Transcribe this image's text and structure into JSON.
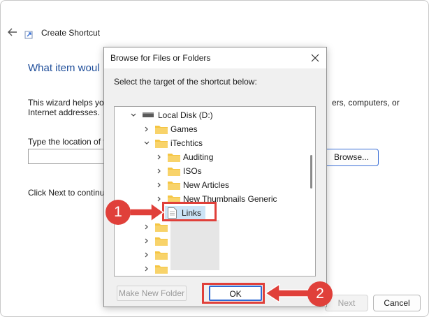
{
  "wizard": {
    "title": "Create Shortcut",
    "heading": "What item woul",
    "description_line1": "This wizard helps yo",
    "description_line1_right": "ers, computers, or",
    "description_line2": "Internet addresses.",
    "location_label": "Type the location of t",
    "location_value": "",
    "browse_label": "Browse...",
    "next_text": "Click Next to continu",
    "next_label": "Next",
    "cancel_label": "Cancel"
  },
  "dialog": {
    "title": "Browse for Files or Folders",
    "instruction": "Select the target of the shortcut below:",
    "tree": [
      {
        "label": "Local Disk (D:)",
        "icon": "drive-icon",
        "expanded": true
      },
      {
        "label": "Games",
        "icon": "folder-icon",
        "expanded": false
      },
      {
        "label": "iTechtics",
        "icon": "folder-icon",
        "expanded": true
      },
      {
        "label": "Auditing",
        "icon": "folder-icon",
        "expanded": false
      },
      {
        "label": "ISOs",
        "icon": "folder-icon",
        "expanded": false
      },
      {
        "label": "New Articles",
        "icon": "folder-icon",
        "expanded": false
      },
      {
        "label": "New Thumbnails Generic",
        "icon": "folder-icon",
        "expanded": false
      },
      {
        "label": "Links",
        "icon": "file-icon",
        "selected": true
      },
      {
        "label": "",
        "icon": "folder-icon",
        "expanded": false
      },
      {
        "label": "",
        "icon": "folder-icon",
        "expanded": false
      },
      {
        "label": "",
        "icon": "folder-icon",
        "expanded": false
      },
      {
        "label": "",
        "icon": "folder-icon",
        "expanded": false
      }
    ],
    "new_folder_label": "Make New Folder",
    "ok_label": "OK"
  },
  "annotations": {
    "step1": "1",
    "step2": "2",
    "color": "#e0403a"
  },
  "colors": {
    "heading": "#1f4e9a",
    "accent": "#2f6bd4",
    "folder": "#f5c542",
    "selection": "#cce4f7"
  }
}
